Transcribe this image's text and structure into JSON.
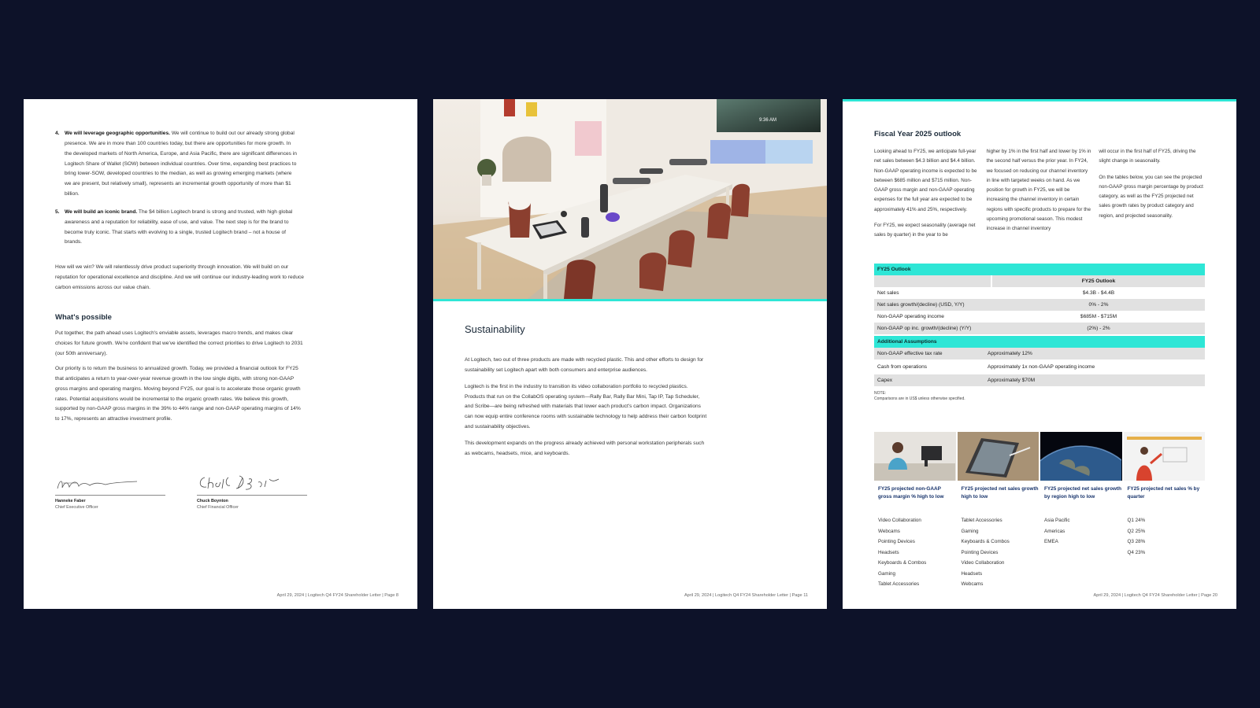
{
  "colors": {
    "background": "#0d1229",
    "accent": "#2ee6d6",
    "heading": "#1c2b3a",
    "tile_heading": "#17336b"
  },
  "page1": {
    "items": [
      {
        "num": "4.",
        "bold": "We will leverage geographic opportunities.",
        "text": " We will continue to build out our already strong global presence. We are in more than 100 countries today, but there are opportunities for more growth. In the developed markets of North America, Europe, and Asia Pacific, there are significant differences in Logitech Share of Wallet (SOW) between individual countries. Over time, expanding best practices to bring lower-SOW, developed countries to the median, as well as growing emerging markets (where we are present, but relatively small), represents an incremental growth opportunity of more than $1 billion."
      },
      {
        "num": "5.",
        "bold": "We will build an iconic brand.",
        "text": " The $4 billion Logitech brand is strong and trusted, with high global awareness and a reputation for reliability, ease of use, and value. The next step is for the brand to become truly iconic. That starts with evolving to a single, trusted Logitech brand – not a house of brands."
      }
    ],
    "para_win": "How will we win? We will relentlessly drive product superiority through innovation. We will build on our reputation for operational excellence and discipline. And we will continue our industry-leading work to reduce carbon emissions across our value chain.",
    "section_title": "What's possible",
    "para_possible_1": "Put together, the path ahead uses Logitech's enviable assets, leverages macro trends, and makes clear choices for future growth. We're confident that we've identified the correct priorities to drive Logitech to 2031 (our 50th anniversary).",
    "para_possible_2": "Our priority is to return the business to annualized growth. Today, we provided a financial outlook for FY25 that anticipates a return to year-over-year revenue growth in the low single digits, with strong non-GAAP gross margins and operating margins. Moving beyond FY25, our goal is to accelerate those organic growth rates. Potential acquisitions would be incremental to the organic growth rates. We believe this growth, supported by non-GAAP gross margins in the 39% to 44% range and non-GAAP operating margins of 14% to 17%, represents an attractive investment profile.",
    "signatures": [
      {
        "name": "Hanneke Faber",
        "title": "Chief Executive Officer"
      },
      {
        "name": "Chuck Boynton",
        "title": "Chief Financial Officer"
      }
    ],
    "footer": "April 29, 2024 | Logitech Q4 FY24 Shareholder Letter | Page 8"
  },
  "page2": {
    "photo_clock": "9:36 AM",
    "title": "Sustainability",
    "paragraphs": [
      "At Logitech, two out of three products are made with recycled plastic. This and other efforts to design for sustainability set Logitech apart with both consumers and enterprise audiences.",
      "Logitech is the first in the industry to transition its video collaboration portfolio to recycled plastics. Products that run on the CollabOS operating system—Rally Bar, Rally Bar Mini, Tap IP, Tap Scheduler, and Scribe—are being refreshed with materials that lower each product's carbon impact. Organizations can now equip entire conference rooms with sustainable technology to help address their carbon footprint and sustainability objectives.",
      "This development expands on the progress already achieved with personal workstation peripherals such as webcams, headsets, mice, and keyboards."
    ],
    "footer": "April 29, 2024 | Logitech Q4 FY24 Shareholder Letter | Page 11"
  },
  "page3": {
    "title": "Fiscal Year 2025 outlook",
    "col1": [
      "Looking ahead to FY25, we anticipate full-year net sales between $4.3 billion and $4.4 billion. Non-GAAP operating income is expected to be between $685 million and $715 million. Non-GAAP gross margin and non-GAAP operating expenses for the full year are expected to be approximately 41% and 25%, respectively.",
      "For FY25, we expect seasonality (average net sales by quarter) in the year to be"
    ],
    "col2": [
      "higher by 1% in the first half and lower by 1% in the second half versus the prior year. In FY24, we focused on reducing our channel inventory in line with targeted weeks on hand. As we position for growth in FY25, we will be increasing the channel inventory in certain regions with specific products to prepare for the upcoming promotional season. This modest increase in channel inventory"
    ],
    "col3": [
      "will occur in the first half of FY25, driving the slight change in seasonality.",
      "On the tables below, you can see the projected non-GAAP gross margin percentage by product category, as well as the FY25 projected net sales growth rates by product category and region, and projected seasonality."
    ],
    "table": {
      "heading": "FY25 Outlook",
      "col_header": "FY25 Outlook",
      "rows": [
        {
          "label": "Net sales",
          "value": "$4.3B - $4.4B"
        },
        {
          "label": "Net sales growth/(decline) (USD, Y/Y)",
          "value": "0% - 2%"
        },
        {
          "label": "Non-GAAP operating income",
          "value": "$685M - $715M"
        },
        {
          "label": "Non-GAAP op inc. growth/(decline) (Y/Y)",
          "value": "(2%) - 2%"
        }
      ],
      "assumptions_heading": "Additional Assumptions",
      "assumptions": [
        {
          "label": "Non-GAAP effective tax rate",
          "value": "Approximately 12%"
        },
        {
          "label": "Cash from operations",
          "value": "Approximately 1x non-GAAP operating income"
        },
        {
          "label": "Capex",
          "value": "Approximately $70M"
        }
      ],
      "note_label": "NOTE:",
      "note_text": "Comparisons are in US$ unless otherwise specified."
    },
    "tiles": [
      {
        "heading": "FY25 projected non-GAAP gross margin % high to low",
        "items": [
          "Video Collaboration",
          "Webcams",
          "Pointing Devices",
          "Headsets",
          "Keyboards & Combos",
          "Gaming",
          "Tablet Accessories"
        ]
      },
      {
        "heading": "FY25 projected net sales growth high to low",
        "items": [
          "Tablet Accessories",
          "Gaming",
          "Keyboards & Combos",
          "Pointing Devices",
          "Video Collaboration",
          "Headsets",
          "Webcams"
        ]
      },
      {
        "heading": "FY25 projected net sales growth by region high to low",
        "items": [
          "Asia Pacific",
          "Americas",
          "EMEA"
        ]
      },
      {
        "heading": "FY25 projected net sales % by quarter",
        "items": [
          "Q1 24%",
          "Q2 25%",
          "Q3 28%",
          "Q4 23%"
        ]
      }
    ],
    "footer": "April 29, 2024 | Logitech Q4 FY24 Shareholder Letter | Page 20"
  }
}
